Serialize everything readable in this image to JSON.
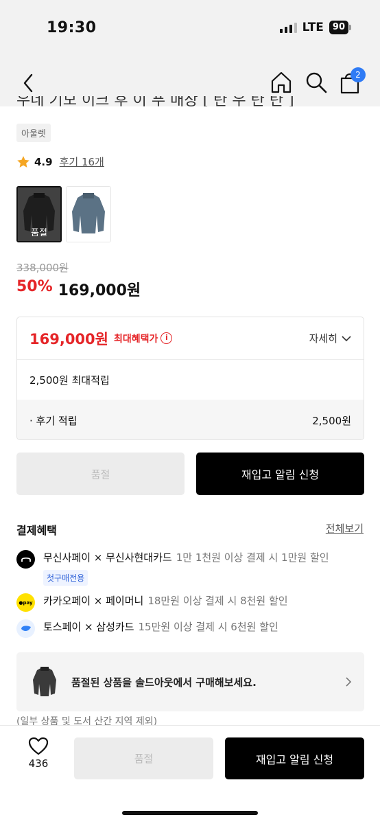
{
  "status_bar": {
    "time": "19:30",
    "network": "LTE",
    "battery": "90"
  },
  "nav": {
    "cart_count": "2"
  },
  "product": {
    "title_cut": "우네 기모 이크 후 이 푸 매장 [ 탄 우 탄 탄 ]",
    "brand_tag": "아울렛",
    "rating": "4.9",
    "reviews": "후기 16개",
    "thumb_soldout_label": "품절",
    "original_price": "338,000원",
    "discount": "50%",
    "sale_price": "169,000원"
  },
  "benefit": {
    "price": "169,000원",
    "max_label": "최대혜택가",
    "detail_label": "자세히",
    "points_label": "2,500원 최대적립",
    "review_points_label": "· 후기 적립",
    "review_points_amount": "2,500원"
  },
  "actions": {
    "soldout_label": "품절",
    "restock_label": "재입고 알림 신청"
  },
  "payment": {
    "title": "결제혜택",
    "view_all": "전체보기",
    "items": [
      {
        "main": "무신사페이 × 무신사현대카드",
        "sub": "1만 1천원 이상 결제 시 1만원 할인",
        "tag": "첫구매전용",
        "logo_color": "#000000",
        "icon": "musinsa-pay-icon"
      },
      {
        "main": "카카오페이 × 페이머니",
        "sub": "18만원 이상 결제 시 8천원 할인",
        "logo_color": "#ffe100",
        "icon": "kakao-pay-icon",
        "logo_text": "●pay"
      },
      {
        "main": "토스페이 × 삼성카드",
        "sub": "15만원 이상 결제 시 6천원 할인",
        "logo_color": "#e8f1ff",
        "icon": "toss-pay-icon"
      }
    ]
  },
  "soldout_banner": {
    "text": "품절된 상품을 솔드아웃에서 구매해보세요."
  },
  "cut_note": "(일부 상품 및 도서 산간 지역 제외)",
  "bottom": {
    "like_count": "436",
    "soldout_label": "품절",
    "restock_label": "재입고 알림 신청"
  }
}
